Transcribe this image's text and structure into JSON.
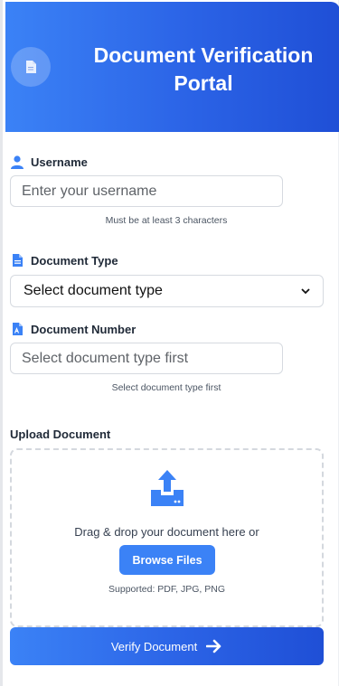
{
  "header": {
    "title": "Document Verification Portal",
    "icon": "document-icon"
  },
  "username": {
    "label": "Username",
    "icon": "user-icon",
    "placeholder": "Enter your username",
    "value": "",
    "hint": "Must be at least 3 characters"
  },
  "document_type": {
    "label": "Document Type",
    "icon": "document-icon",
    "selected": "Select document type"
  },
  "document_number": {
    "label": "Document Number",
    "icon": "pdf-document-icon",
    "placeholder": "Select document type first",
    "value": "",
    "hint": "Select document type first"
  },
  "upload": {
    "title": "Upload Document",
    "icon": "upload-icon",
    "drop_text": "Drag & drop your document here or",
    "browse_label": "Browse Files",
    "supported": "Supported: PDF, JPG, PNG"
  },
  "verify_button": {
    "label": "Verify Document",
    "icon": "arrow-right-icon"
  },
  "colors": {
    "accent": "#3b82f6",
    "accent_dark": "#1f4fd6"
  }
}
